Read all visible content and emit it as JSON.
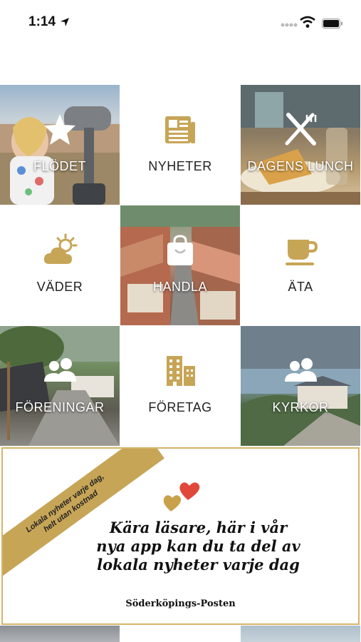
{
  "status_bar": {
    "time": "1:14"
  },
  "tiles": [
    {
      "label": "FLÖDET",
      "icon": "star-icon"
    },
    {
      "label": "NYHETER",
      "icon": "newspaper-icon"
    },
    {
      "label": "DAGENS LUNCH",
      "icon": "fork-knife-icon"
    },
    {
      "label": "VÄDER",
      "icon": "weather-icon"
    },
    {
      "label": "HANDLA",
      "icon": "shopping-bag-icon"
    },
    {
      "label": "ÄTA",
      "icon": "coffee-cup-icon"
    },
    {
      "label": "FÖRENINGAR",
      "icon": "people-icon"
    },
    {
      "label": "FÖRETAG",
      "icon": "building-icon"
    },
    {
      "label": "KYRKOR",
      "icon": "people-icon"
    }
  ],
  "banner": {
    "ribbon_line1": "Lokala nyheter varje dag,",
    "ribbon_line2": "helt utan kostnad",
    "message_line1": "Kära läsare, här i vår",
    "message_line2": "nya app kan du ta del av",
    "message_line3": "lokala nyheter varje dag",
    "brand": "Söderköpings-Posten"
  },
  "colors": {
    "gold": "#c7a557",
    "heart_red": "#e0483a",
    "heart_gold": "#c9a14a"
  }
}
